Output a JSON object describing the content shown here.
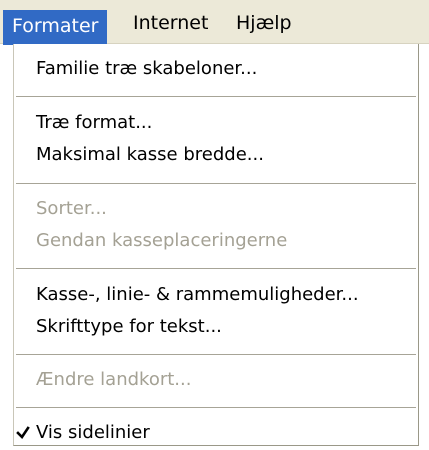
{
  "menubar": {
    "items": [
      {
        "label": "Formater"
      },
      {
        "label": "Internet"
      },
      {
        "label": "Hjælp"
      }
    ]
  },
  "dropdown": {
    "items": [
      {
        "label": "Familie træ skabeloner...",
        "enabled": true
      },
      {
        "label": "Træ format...",
        "enabled": true
      },
      {
        "label": "Maksimal kasse bredde...",
        "enabled": true
      },
      {
        "label": "Sorter...",
        "enabled": false
      },
      {
        "label": "Gendan kasseplaceringerne",
        "enabled": false
      },
      {
        "label": "Kasse-, linie- & rammemuligheder...",
        "enabled": true
      },
      {
        "label": "Skrifttype for tekst...",
        "enabled": true
      },
      {
        "label": "Ændre landkort...",
        "enabled": false
      },
      {
        "label": "Vis sidelinier",
        "enabled": true,
        "checked": true
      }
    ]
  },
  "colors": {
    "menubar_bg": "#ece9d8",
    "highlight": "#316ac5",
    "disabled_text": "#a4a194"
  },
  "icons": {
    "check": "check-icon"
  }
}
